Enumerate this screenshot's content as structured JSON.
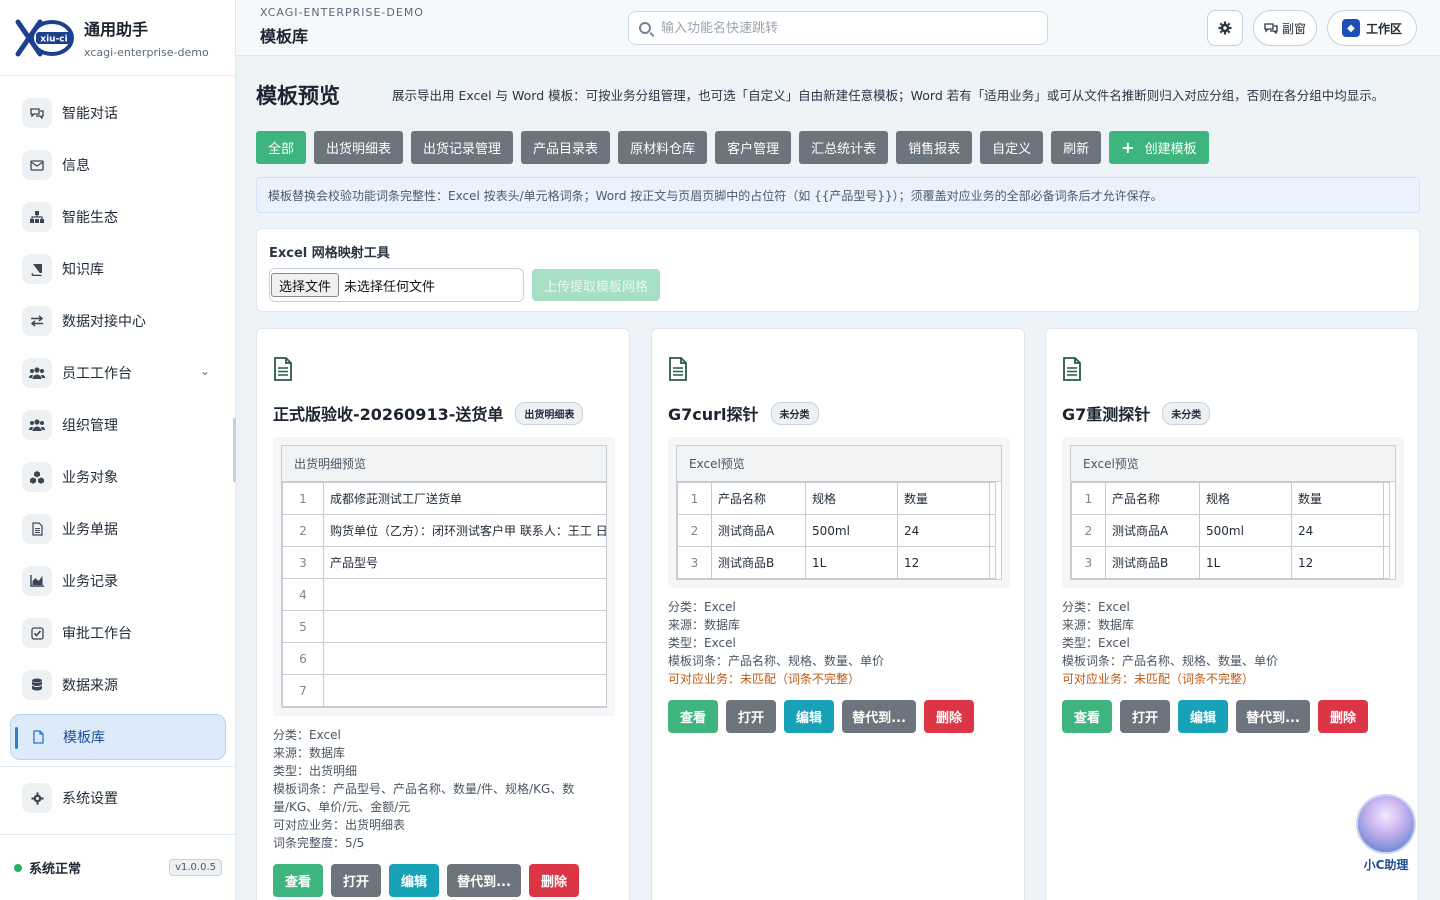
{
  "brand": {
    "logo_text": "xiu-ci",
    "title": "通用助手",
    "subtitle": "xcagi-enterprise-demo"
  },
  "sidebar": {
    "items": [
      {
        "label": "智能对话",
        "icon": "chat-icon"
      },
      {
        "label": "信息",
        "icon": "mail-icon"
      },
      {
        "label": "智能生态",
        "icon": "sitemap-icon"
      },
      {
        "label": "知识库",
        "icon": "book-icon"
      },
      {
        "label": "数据对接中心",
        "icon": "exchange-icon"
      },
      {
        "label": "员工工作台",
        "icon": "users-icon",
        "has_chevron": true
      },
      {
        "label": "组织管理",
        "icon": "users-icon"
      },
      {
        "label": "业务对象",
        "icon": "cubes-icon"
      },
      {
        "label": "业务单据",
        "icon": "file-text-icon"
      },
      {
        "label": "业务记录",
        "icon": "chart-area-icon"
      },
      {
        "label": "审批工作台",
        "icon": "check-square-icon"
      },
      {
        "label": "数据来源",
        "icon": "database-icon"
      },
      {
        "label": "模板库",
        "icon": "file-icon",
        "active": true
      }
    ],
    "settings_label": "系统设置",
    "status_text": "系统正常",
    "version": "v1.0.0.5"
  },
  "topbar": {
    "org": "XCAGI-ENTERPRISE-DEMO",
    "page_name": "模板库",
    "search_placeholder": "输入功能名快速跳转",
    "float_label": "副窗",
    "work_label": "工作区"
  },
  "main": {
    "heading": "模板预览",
    "description": "展示导出用 Excel 与 Word 模板：可按业务分组管理，也可选「自定义」自由新建任意模板；Word 若有「适用业务」或可从文件名推断则归入对应分组，否则在各分组中均显示。",
    "tabs": [
      "全部",
      "出货明细表",
      "出货记录管理",
      "产品目录表",
      "原材料仓库",
      "客户管理",
      "汇总统计表",
      "销售报表",
      "自定义",
      "刷新"
    ],
    "create_label": "创建模板",
    "notice": "模板替换会校验功能词条完整性：Excel 按表头/单元格词条；Word 按正文与页眉页脚中的占位符（如 {{产品型号}}）；须覆盖对应业务的全部必备词条后才允许保存。",
    "excel_tool": {
      "title": "Excel 网格映射工具",
      "file_button": "选择文件",
      "file_none": "未选择任何文件",
      "upload_label": "上传提取模板网格"
    }
  },
  "cards": [
    {
      "title": "正式版验收-20260913-送货单",
      "badge": "出货明细表",
      "preview_title": "出货明细预览",
      "rows": [
        {
          "n": "1",
          "cells": [
            "成都修茈测试工厂送货单"
          ]
        },
        {
          "n": "2",
          "cells": [
            "购货单位（乙方）：闭环测试客户甲 联系人：王工 日"
          ]
        },
        {
          "n": "3",
          "cells": [
            "产品型号"
          ]
        },
        {
          "n": "4",
          "cells": [
            ""
          ]
        },
        {
          "n": "5",
          "cells": [
            ""
          ]
        },
        {
          "n": "6",
          "cells": [
            ""
          ]
        },
        {
          "n": "7",
          "cells": [
            ""
          ]
        }
      ],
      "meta": [
        "分类：Excel",
        "来源：数据库",
        "类型：出货明细",
        "模板词条：产品型号、产品名称、数量/件、规格/KG、数量/KG、单价/元、金额/元",
        "可对应业务：出货明细表",
        "词条完整度：5/5"
      ],
      "warning": ""
    },
    {
      "title": "G7curl探针",
      "badge": "未分类",
      "preview_title": "Excel预览",
      "rows": [
        {
          "n": "1",
          "cells": [
            "产品名称",
            "规格",
            "数量"
          ]
        },
        {
          "n": "2",
          "cells": [
            "测试商品A",
            "500ml",
            "24"
          ]
        },
        {
          "n": "3",
          "cells": [
            "测试商品B",
            "1L",
            "12"
          ]
        }
      ],
      "meta": [
        "分类：Excel",
        "来源：数据库",
        "类型：Excel",
        "模板词条：产品名称、规格、数量、单价"
      ],
      "warning": "可对应业务：未匹配（词条不完整）"
    },
    {
      "title": "G7重测探针",
      "badge": "未分类",
      "preview_title": "Excel预览",
      "rows": [
        {
          "n": "1",
          "cells": [
            "产品名称",
            "规格",
            "数量"
          ]
        },
        {
          "n": "2",
          "cells": [
            "测试商品A",
            "500ml",
            "24"
          ]
        },
        {
          "n": "3",
          "cells": [
            "测试商品B",
            "1L",
            "12"
          ]
        }
      ],
      "meta": [
        "分类：Excel",
        "来源：数据库",
        "类型：Excel",
        "模板词条：产品名称、规格、数量、单价"
      ],
      "warning": "可对应业务：未匹配（词条不完整）"
    }
  ],
  "card_actions": [
    "查看",
    "打开",
    "编辑",
    "替代到...",
    "删除"
  ],
  "assistant": {
    "label": "小C助理"
  },
  "colors": {
    "primary_green": "#3eb57f",
    "secondary_gray": "#6c757d",
    "info_teal": "#17a2b8",
    "danger_red": "#dc3545",
    "warning_orange": "#c05a14",
    "accent_blue": "#2f7bd8"
  }
}
